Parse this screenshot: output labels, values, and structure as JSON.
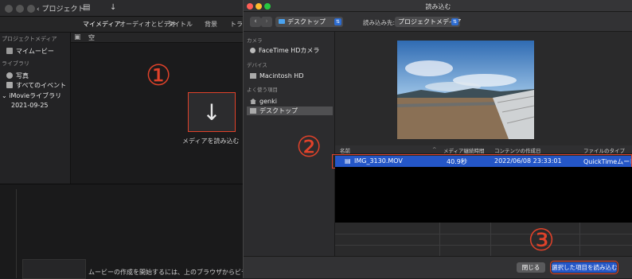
{
  "imovie": {
    "back_label": "プロジェクト",
    "tabs": [
      "マイメディア",
      "オーディオとビデオ",
      "タイトル",
      "背景",
      "トラ"
    ],
    "media_header_label": "空",
    "sidebar": {
      "section_project_media": "プロジェクトメディア",
      "item_my_movie": "マイムービー",
      "section_library": "ライブラリ",
      "item_photos": "写真",
      "item_all_events": "すべてのイベント",
      "item_imovie_library": "iMovieライブラリ",
      "item_date": "2021-09-25"
    },
    "import_label": "メディアを読み込む",
    "timeline_hint": "ムービーの作成を開始するには、上のブラウザからビデ"
  },
  "annotations": {
    "one": "①",
    "two": "②",
    "three": "③",
    "color": "#e0422a"
  },
  "dialog": {
    "title": "読み込む",
    "location": "デスクトップ",
    "import_to_label": "読み込み先:",
    "import_to_value": "プロジェクトメディア",
    "sidebar": {
      "section_camera": "カメラ",
      "item_facetime": "FaceTime HDカメラ",
      "section_devices": "デバイス",
      "item_macintosh": "Macintosh HD",
      "section_favorites": "よく使う項目",
      "item_genki": "genki",
      "item_desktop": "デスクトップ"
    },
    "table": {
      "headers": [
        "名前",
        "メディア継続時間",
        "コンテンツの作成日",
        "ファイルのタイプ"
      ],
      "rows": [
        {
          "name": "IMG_3130.MOV",
          "duration": "40.9秒",
          "created": "2022/06/08 23:33:01",
          "type": "QuickTimeムービー"
        }
      ]
    },
    "buttons": {
      "close": "閉じる",
      "import_selected": "選択した項目を読み込む"
    },
    "accent": "#2456c7"
  }
}
